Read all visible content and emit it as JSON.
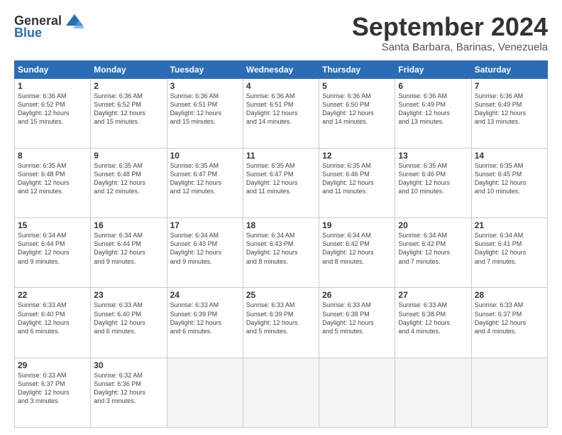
{
  "header": {
    "logo_general": "General",
    "logo_blue": "Blue",
    "month_title": "September 2024",
    "location": "Santa Barbara, Barinas, Venezuela"
  },
  "days_of_week": [
    "Sunday",
    "Monday",
    "Tuesday",
    "Wednesday",
    "Thursday",
    "Friday",
    "Saturday"
  ],
  "weeks": [
    [
      {
        "day": "1",
        "info": "Sunrise: 6:36 AM\nSunset: 6:52 PM\nDaylight: 12 hours\nand 15 minutes."
      },
      {
        "day": "2",
        "info": "Sunrise: 6:36 AM\nSunset: 6:52 PM\nDaylight: 12 hours\nand 15 minutes."
      },
      {
        "day": "3",
        "info": "Sunrise: 6:36 AM\nSunset: 6:51 PM\nDaylight: 12 hours\nand 15 minutes."
      },
      {
        "day": "4",
        "info": "Sunrise: 6:36 AM\nSunset: 6:51 PM\nDaylight: 12 hours\nand 14 minutes."
      },
      {
        "day": "5",
        "info": "Sunrise: 6:36 AM\nSunset: 6:50 PM\nDaylight: 12 hours\nand 14 minutes."
      },
      {
        "day": "6",
        "info": "Sunrise: 6:36 AM\nSunset: 6:49 PM\nDaylight: 12 hours\nand 13 minutes."
      },
      {
        "day": "7",
        "info": "Sunrise: 6:36 AM\nSunset: 6:49 PM\nDaylight: 12 hours\nand 13 minutes."
      }
    ],
    [
      {
        "day": "8",
        "info": "Sunrise: 6:35 AM\nSunset: 6:48 PM\nDaylight: 12 hours\nand 12 minutes."
      },
      {
        "day": "9",
        "info": "Sunrise: 6:35 AM\nSunset: 6:48 PM\nDaylight: 12 hours\nand 12 minutes."
      },
      {
        "day": "10",
        "info": "Sunrise: 6:35 AM\nSunset: 6:47 PM\nDaylight: 12 hours\nand 12 minutes."
      },
      {
        "day": "11",
        "info": "Sunrise: 6:35 AM\nSunset: 6:47 PM\nDaylight: 12 hours\nand 11 minutes."
      },
      {
        "day": "12",
        "info": "Sunrise: 6:35 AM\nSunset: 6:46 PM\nDaylight: 12 hours\nand 11 minutes."
      },
      {
        "day": "13",
        "info": "Sunrise: 6:35 AM\nSunset: 6:46 PM\nDaylight: 12 hours\nand 10 minutes."
      },
      {
        "day": "14",
        "info": "Sunrise: 6:35 AM\nSunset: 6:45 PM\nDaylight: 12 hours\nand 10 minutes."
      }
    ],
    [
      {
        "day": "15",
        "info": "Sunrise: 6:34 AM\nSunset: 6:44 PM\nDaylight: 12 hours\nand 9 minutes."
      },
      {
        "day": "16",
        "info": "Sunrise: 6:34 AM\nSunset: 6:44 PM\nDaylight: 12 hours\nand 9 minutes."
      },
      {
        "day": "17",
        "info": "Sunrise: 6:34 AM\nSunset: 6:43 PM\nDaylight: 12 hours\nand 9 minutes."
      },
      {
        "day": "18",
        "info": "Sunrise: 6:34 AM\nSunset: 6:43 PM\nDaylight: 12 hours\nand 8 minutes."
      },
      {
        "day": "19",
        "info": "Sunrise: 6:34 AM\nSunset: 6:42 PM\nDaylight: 12 hours\nand 8 minutes."
      },
      {
        "day": "20",
        "info": "Sunrise: 6:34 AM\nSunset: 6:42 PM\nDaylight: 12 hours\nand 7 minutes."
      },
      {
        "day": "21",
        "info": "Sunrise: 6:34 AM\nSunset: 6:41 PM\nDaylight: 12 hours\nand 7 minutes."
      }
    ],
    [
      {
        "day": "22",
        "info": "Sunrise: 6:33 AM\nSunset: 6:40 PM\nDaylight: 12 hours\nand 6 minutes."
      },
      {
        "day": "23",
        "info": "Sunrise: 6:33 AM\nSunset: 6:40 PM\nDaylight: 12 hours\nand 6 minutes."
      },
      {
        "day": "24",
        "info": "Sunrise: 6:33 AM\nSunset: 6:39 PM\nDaylight: 12 hours\nand 6 minutes."
      },
      {
        "day": "25",
        "info": "Sunrise: 6:33 AM\nSunset: 6:39 PM\nDaylight: 12 hours\nand 5 minutes."
      },
      {
        "day": "26",
        "info": "Sunrise: 6:33 AM\nSunset: 6:38 PM\nDaylight: 12 hours\nand 5 minutes."
      },
      {
        "day": "27",
        "info": "Sunrise: 6:33 AM\nSunset: 6:38 PM\nDaylight: 12 hours\nand 4 minutes."
      },
      {
        "day": "28",
        "info": "Sunrise: 6:33 AM\nSunset: 6:37 PM\nDaylight: 12 hours\nand 4 minutes."
      }
    ],
    [
      {
        "day": "29",
        "info": "Sunrise: 6:33 AM\nSunset: 6:37 PM\nDaylight: 12 hours\nand 3 minutes."
      },
      {
        "day": "30",
        "info": "Sunrise: 6:32 AM\nSunset: 6:36 PM\nDaylight: 12 hours\nand 3 minutes."
      },
      {
        "day": "",
        "info": ""
      },
      {
        "day": "",
        "info": ""
      },
      {
        "day": "",
        "info": ""
      },
      {
        "day": "",
        "info": ""
      },
      {
        "day": "",
        "info": ""
      }
    ]
  ]
}
